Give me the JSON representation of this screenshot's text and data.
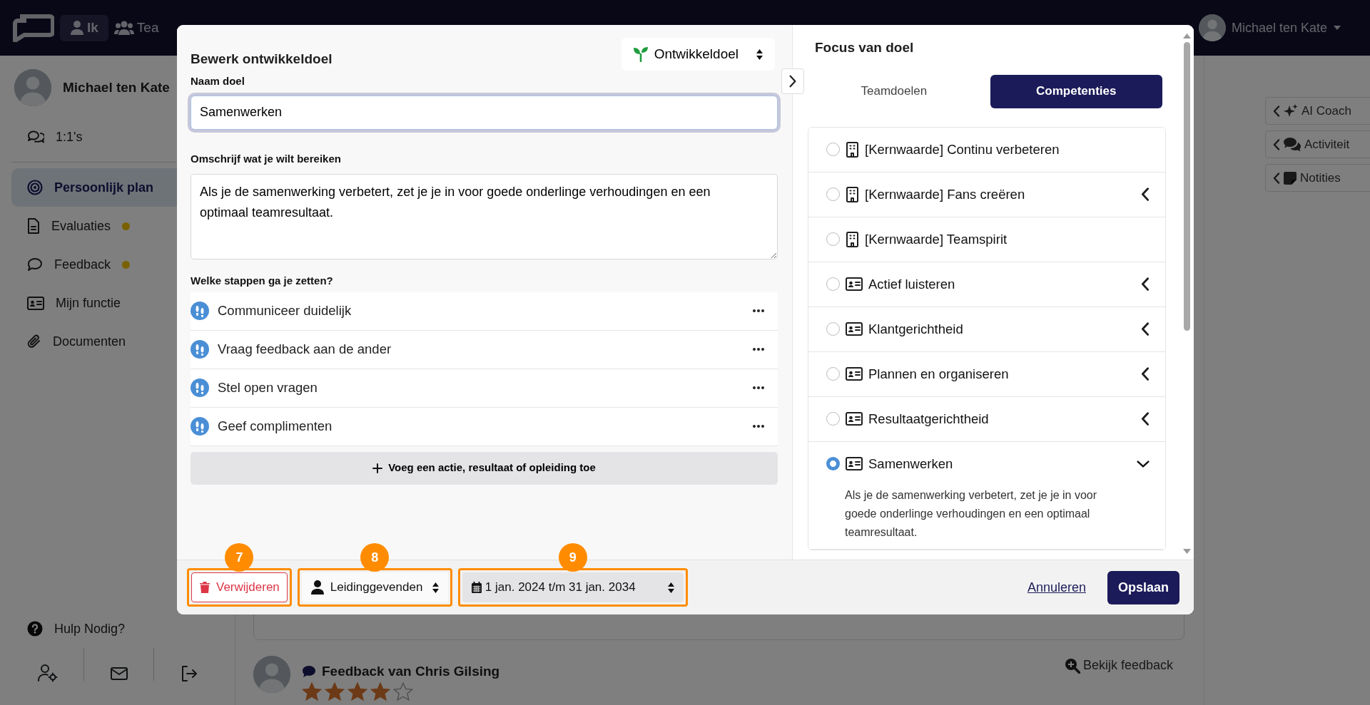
{
  "navbar": {
    "menu": [
      {
        "label": "Ik",
        "selected": true
      },
      {
        "label": "Tea",
        "selected": false
      }
    ],
    "user": "Michael ten Kate"
  },
  "sidebar": {
    "profile_name": "Michael ten Kate",
    "top_item": "1:1's",
    "items": [
      {
        "label": "Persoonlijk plan",
        "selected": true,
        "notification": false
      },
      {
        "label": "Evaluaties",
        "selected": false,
        "notification": true
      },
      {
        "label": "Feedback",
        "selected": false,
        "notification": true
      },
      {
        "label": "Mijn functie",
        "selected": false,
        "notification": false
      },
      {
        "label": "Documenten",
        "selected": false,
        "notification": false
      }
    ],
    "help": "Hulp Nodig?"
  },
  "side_panel": {
    "tabs": [
      "AI Coach",
      "Activiteit",
      "Notities"
    ]
  },
  "feedback": {
    "title": "Feedback van Chris Gilsing",
    "stars": 4,
    "link": "Bekijk feedback"
  },
  "dialog": {
    "title": "Bewerk ontwikkeldoel",
    "type_select": "Ontwikkeldoel",
    "name_label": "Naam doel",
    "name_value": "Samenwerken",
    "description_label": "Omschrijf wat je wilt bereiken",
    "description_value": "Als je de samenwerking verbetert, zet je je in voor goede onderlinge verhoudingen en een optimaal teamresultaat.",
    "steps_label": "Welke stappen ga je zetten?",
    "steps": [
      "Communiceer duidelijk",
      "Vraag feedback aan de ander",
      "Stel open vragen",
      "Geef complimenten"
    ],
    "add_button": "Voeg een actie, resultaat of opleiding toe",
    "focus": {
      "title": "Focus van doel",
      "tabs": [
        {
          "label": "Teamdoelen",
          "selected": false
        },
        {
          "label": "Competenties",
          "selected": true
        }
      ],
      "options": [
        {
          "label": "[Kernwaarde] Continu verbeteren",
          "kind": "core-value",
          "selected": false,
          "expandable": false,
          "expanded": false
        },
        {
          "label": "[Kernwaarde] Fans creëren",
          "kind": "core-value",
          "selected": false,
          "expandable": true,
          "expanded": false
        },
        {
          "label": "[Kernwaarde] Teamspirit",
          "kind": "core-value",
          "selected": false,
          "expandable": false,
          "expanded": false
        },
        {
          "label": "Actief luisteren",
          "kind": "competency",
          "selected": false,
          "expandable": true,
          "expanded": false
        },
        {
          "label": "Klantgerichtheid",
          "kind": "competency",
          "selected": false,
          "expandable": true,
          "expanded": false
        },
        {
          "label": "Plannen en organiseren",
          "kind": "competency",
          "selected": false,
          "expandable": true,
          "expanded": false
        },
        {
          "label": "Resultaatgerichtheid",
          "kind": "competency",
          "selected": false,
          "expandable": true,
          "expanded": false
        },
        {
          "label": "Samenwerken",
          "kind": "competency",
          "selected": true,
          "expandable": true,
          "expanded": true,
          "description": "Als je de samenwerking verbetert, zet je je in voor goede onderlinge verhoudingen en een optimaal teamresultaat."
        }
      ]
    },
    "footer": {
      "delete_button": {
        "label": "Verwijderen",
        "callout": "7"
      },
      "visibility_select": {
        "label": "Leidinggevenden",
        "callout": "8"
      },
      "period_select": {
        "label": "1 jan. 2024 t/m 31 jan. 2034",
        "callout": "9"
      },
      "cancel": "Annuleren",
      "save": "Opslaan"
    }
  }
}
